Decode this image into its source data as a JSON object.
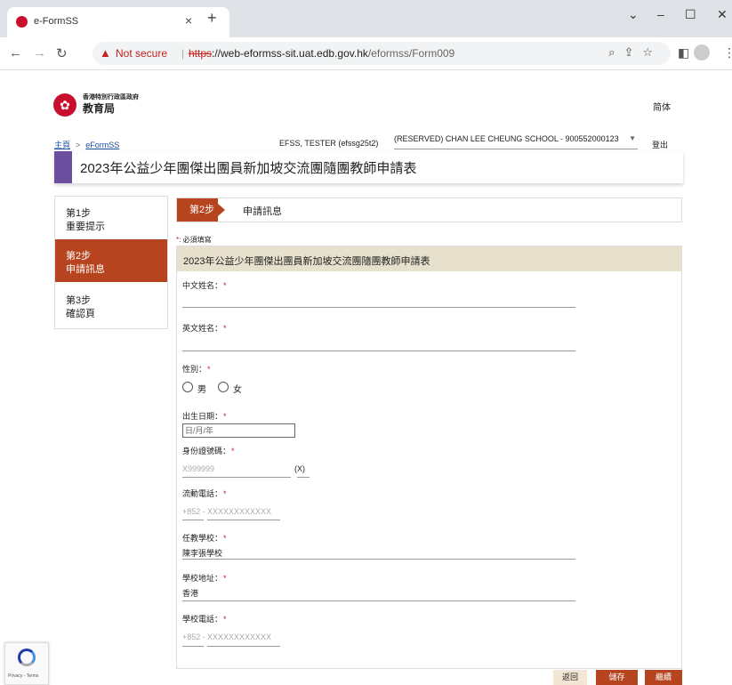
{
  "browser": {
    "tab_title": "e-FormSS",
    "tab_close": "×",
    "new_tab": "+",
    "win_min": "–",
    "win_max": "☐",
    "win_close": "✕",
    "dropdown": "⌄",
    "not_secure": "Not secure",
    "url_scheme": "https",
    "url_host": "://web-eformss-sit.uat.edb.gov.hk",
    "url_path": "/eformss/Form009"
  },
  "header": {
    "logo_sub": "香港特別行政區政府",
    "logo_main": "教育局",
    "lang_link": "简体"
  },
  "topbar": {
    "home": "主頁",
    "separator": ">",
    "eformss": "eFormSS",
    "user": "EFSS, TESTER (efssg25t2)",
    "school": "(RESERVED) CHAN LEE CHEUNG SCHOOL - 900552000123",
    "logout": "登出"
  },
  "page_title": "2023年公益少年團傑出團員新加坡交流團隨團教師申請表",
  "steps": [
    {
      "num": "第1步",
      "label": "重要提示"
    },
    {
      "num": "第2步",
      "label": "申請訊息"
    },
    {
      "num": "第3步",
      "label": "確認頁"
    }
  ],
  "step_header": {
    "tag": "第2步",
    "label": "申請訊息"
  },
  "required_note": {
    "star": "*",
    "text": ": 必須填寫"
  },
  "form": {
    "heading": "2023年公益少年團傑出團員新加坡交流團隨團教師申請表",
    "chinese_name_label": "中文姓名：",
    "english_name_label": "英文姓名：",
    "gender_label": "性別：",
    "gender_male": "男",
    "gender_female": "女",
    "dob_label": "出生日期：",
    "dob_placeholder": "日/月/年",
    "hkid_label": "身份證號碼：",
    "hkid_placeholder": "X999999",
    "hkid_check": "(X)",
    "mobile_label": "流動電話：",
    "mobile_prefix": "+852 -",
    "mobile_placeholder": "XXXXXXXXXXXX",
    "school_label": "任教學校：",
    "school_value": "陳李張學校",
    "address_label": "學校地址：",
    "address_value": "香港",
    "school_phone_label": "學校電話：",
    "school_phone_prefix": "+852 -",
    "school_phone_placeholder": "XXXXXXXXXXXX",
    "star": "*"
  },
  "buttons": {
    "back": "返回",
    "save": "儲存",
    "next": "繼續"
  },
  "recaptcha": {
    "text": "Privacy - Terms"
  }
}
